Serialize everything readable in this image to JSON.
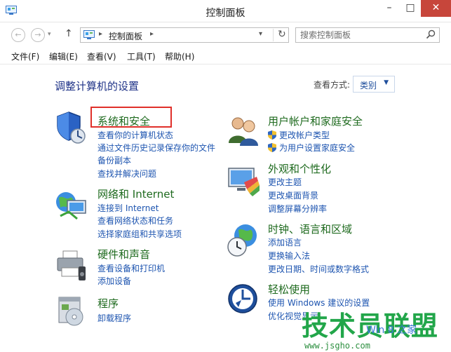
{
  "window": {
    "title": "控制面板",
    "min_label": "–",
    "max_label": "□",
    "close_label": "✕"
  },
  "nav": {
    "back_label": "←",
    "forward_label": "→",
    "recent_label": "▾",
    "up_label": "↑",
    "address_text": "控制面板",
    "address_sep": "▸",
    "address_sep2": "▸",
    "address_dropdown": "▾",
    "refresh_label": "↻",
    "search_placeholder": "搜索控制面板"
  },
  "menu": {
    "file": "文件(F)",
    "edit": "编辑(E)",
    "view": "查看(V)",
    "tools": "工具(T)",
    "help": "帮助(H)"
  },
  "content": {
    "heading": "调整计算机的设置",
    "view_label": "查看方式:",
    "view_value": "类别",
    "view_caret": "▼"
  },
  "categories": {
    "system": {
      "title": "系统和安全",
      "links": [
        "查看你的计算机状态",
        "通过文件历史记录保存你的文件",
        "备份副本",
        "查找并解决问题"
      ]
    },
    "network": {
      "title": "网络和 Internet",
      "links": [
        "连接到 Internet",
        "查看网络状态和任务",
        "选择家庭组和共享选项"
      ]
    },
    "hardware": {
      "title": "硬件和声音",
      "links": [
        "查看设备和打印机",
        "添加设备"
      ]
    },
    "programs": {
      "title": "程序",
      "links": [
        "卸载程序"
      ]
    },
    "users": {
      "title": "用户帐户和家庭安全",
      "links": [
        "更改帐户类型",
        "为用户设置家庭安全"
      ]
    },
    "appearance": {
      "title": "外观和个性化",
      "links": [
        "更改主题",
        "更改桌面背景",
        "调整屏幕分辨率"
      ]
    },
    "clock": {
      "title": "时钟、语言和区域",
      "links": [
        "添加语言",
        "更换输入法",
        "更改日期、时间或数字格式"
      ]
    },
    "ease": {
      "title": "轻松使用",
      "links": [
        "使用 Windows 建议的设置",
        "优化视觉显示"
      ]
    }
  },
  "watermark": {
    "text": "技术员联盟",
    "url": "www.jsgho.com",
    "win": "Win 8 之家"
  },
  "colors": {
    "category_title": "#1e6a1e",
    "link": "#1e55b0",
    "heading": "#1e3287",
    "close_button": "#c7463b",
    "highlight_box": "#e0302a"
  }
}
